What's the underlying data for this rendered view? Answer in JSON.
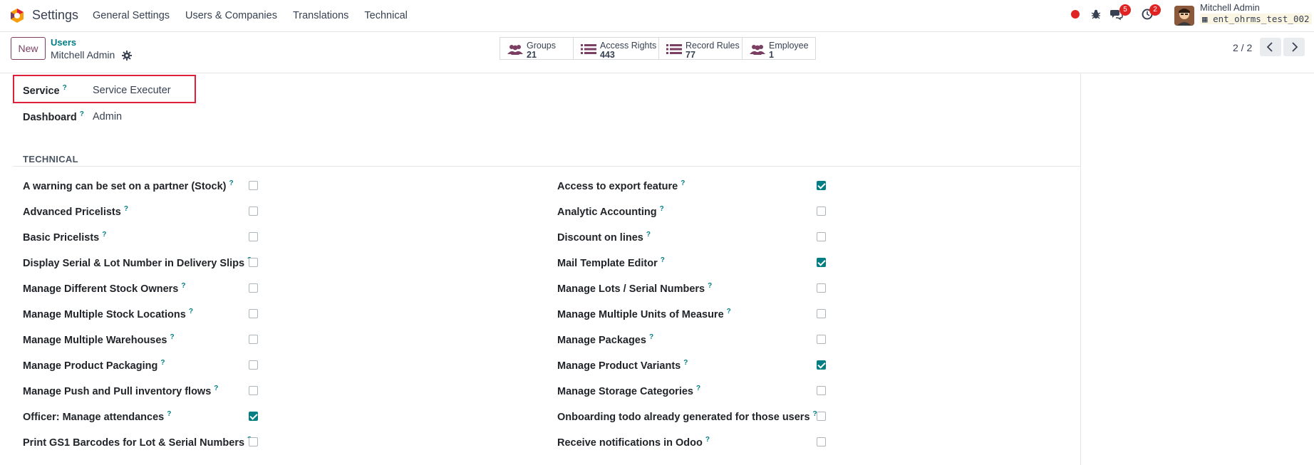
{
  "topnav": {
    "app_title": "Settings",
    "menu": [
      "General Settings",
      "Users & Companies",
      "Translations",
      "Technical"
    ],
    "chat_count": "5",
    "activity_count": "2",
    "user_name": "Mitchell Admin",
    "db_name": "ent_ohrms_test_002"
  },
  "control_panel": {
    "new_label": "New",
    "breadcrumb_parent": "Users",
    "breadcrumb_current": "Mitchell Admin",
    "smart_buttons": [
      {
        "label": "Groups",
        "count": "21",
        "icon": "users-icon"
      },
      {
        "label": "Access Rights",
        "count": "443",
        "icon": "list-icon"
      },
      {
        "label": "Record Rules",
        "count": "77",
        "icon": "list-icon"
      },
      {
        "label": "Employee",
        "count": "1",
        "icon": "users-icon"
      }
    ],
    "pager": "2 / 2"
  },
  "form": {
    "service_label": "Service",
    "service_value": "Service Executer",
    "dashboard_label": "Dashboard",
    "dashboard_value": "Admin",
    "help_mark": "?",
    "section_title": "TECHNICAL",
    "left_rows": [
      {
        "label": "A warning can be set on a partner (Stock)",
        "checked": false
      },
      {
        "label": "Advanced Pricelists",
        "checked": false
      },
      {
        "label": "Basic Pricelists",
        "checked": false
      },
      {
        "label": "Display Serial & Lot Number in Delivery Slips",
        "checked": false
      },
      {
        "label": "Manage Different Stock Owners",
        "checked": false
      },
      {
        "label": "Manage Multiple Stock Locations",
        "checked": false
      },
      {
        "label": "Manage Multiple Warehouses",
        "checked": false
      },
      {
        "label": "Manage Product Packaging",
        "checked": false
      },
      {
        "label": "Manage Push and Pull inventory flows",
        "checked": false
      },
      {
        "label": "Officer: Manage attendances",
        "checked": true
      },
      {
        "label": "Print GS1 Barcodes for Lot & Serial Numbers",
        "checked": false
      }
    ],
    "right_rows": [
      {
        "label": "Access to export feature",
        "checked": true
      },
      {
        "label": "Analytic Accounting",
        "checked": false
      },
      {
        "label": "Discount on lines",
        "checked": false
      },
      {
        "label": "Mail Template Editor",
        "checked": true
      },
      {
        "label": "Manage Lots / Serial Numbers",
        "checked": false
      },
      {
        "label": "Manage Multiple Units of Measure",
        "checked": false
      },
      {
        "label": "Manage Packages",
        "checked": false
      },
      {
        "label": "Manage Product Variants",
        "checked": true
      },
      {
        "label": "Manage Storage Categories",
        "checked": false
      },
      {
        "label": "Onboarding todo already generated for those users",
        "checked": false
      },
      {
        "label": "Receive notifications in Odoo",
        "checked": false
      }
    ]
  },
  "colors": {
    "accent": "#017e84",
    "brand": "#7b3f63",
    "highlight": "#e0203a"
  }
}
